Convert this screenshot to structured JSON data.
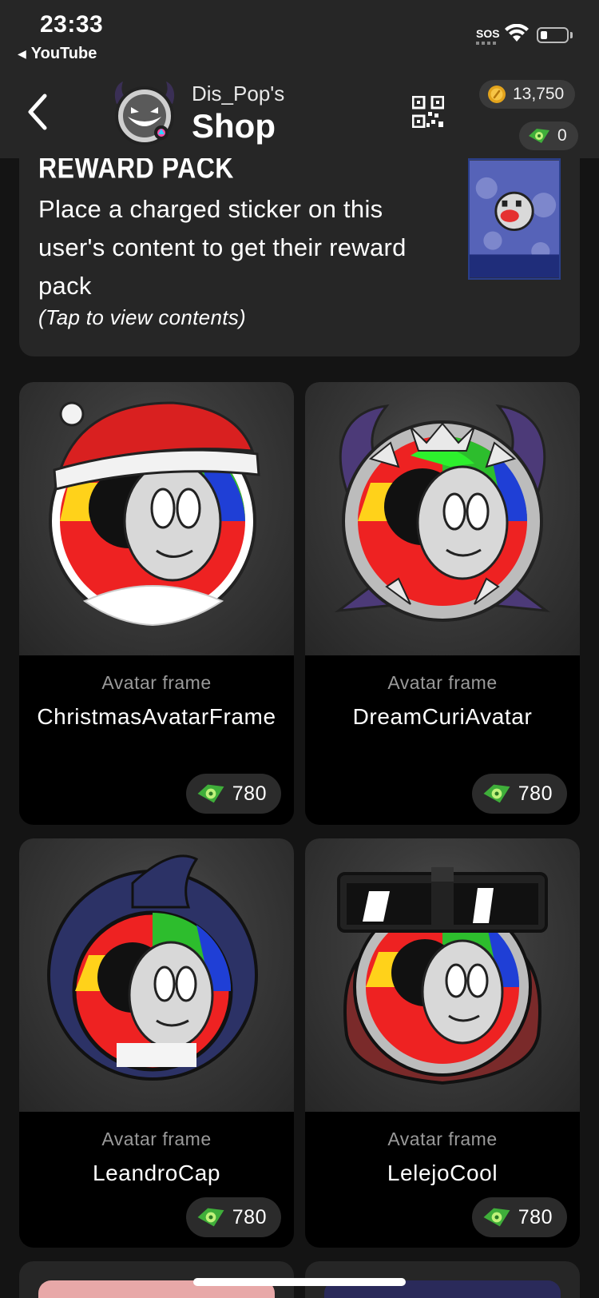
{
  "status": {
    "time": "23:33",
    "back_app": "YouTube",
    "sos": "SOS"
  },
  "header": {
    "owner": "Dis_Pop's",
    "title": "Shop",
    "coins": "13,750",
    "props": "0"
  },
  "reward": {
    "title": "REWARD PACK",
    "description": "Place a charged sticker on this user's content to get their reward pack",
    "hint": "(Tap to view contents)"
  },
  "items": [
    {
      "type": "Avatar frame",
      "name": "ChristmasAvatarFrame",
      "price": "780"
    },
    {
      "type": "Avatar frame",
      "name": "DreamCuriAvatar",
      "price": "780"
    },
    {
      "type": "Avatar frame",
      "name": "LeandroCap",
      "price": "780"
    },
    {
      "type": "Avatar frame",
      "name": "LelejoCool",
      "price": "780"
    }
  ],
  "icons": {
    "nav_back": "chevron-left-icon",
    "qr": "qr-code-icon",
    "coin": "coin-icon",
    "props": "props-icon"
  },
  "colors": {
    "background": "#141414",
    "card": "#262626",
    "pill": "#2b2b2b",
    "coin": "#e2a31c",
    "props": "#3fae3a"
  }
}
